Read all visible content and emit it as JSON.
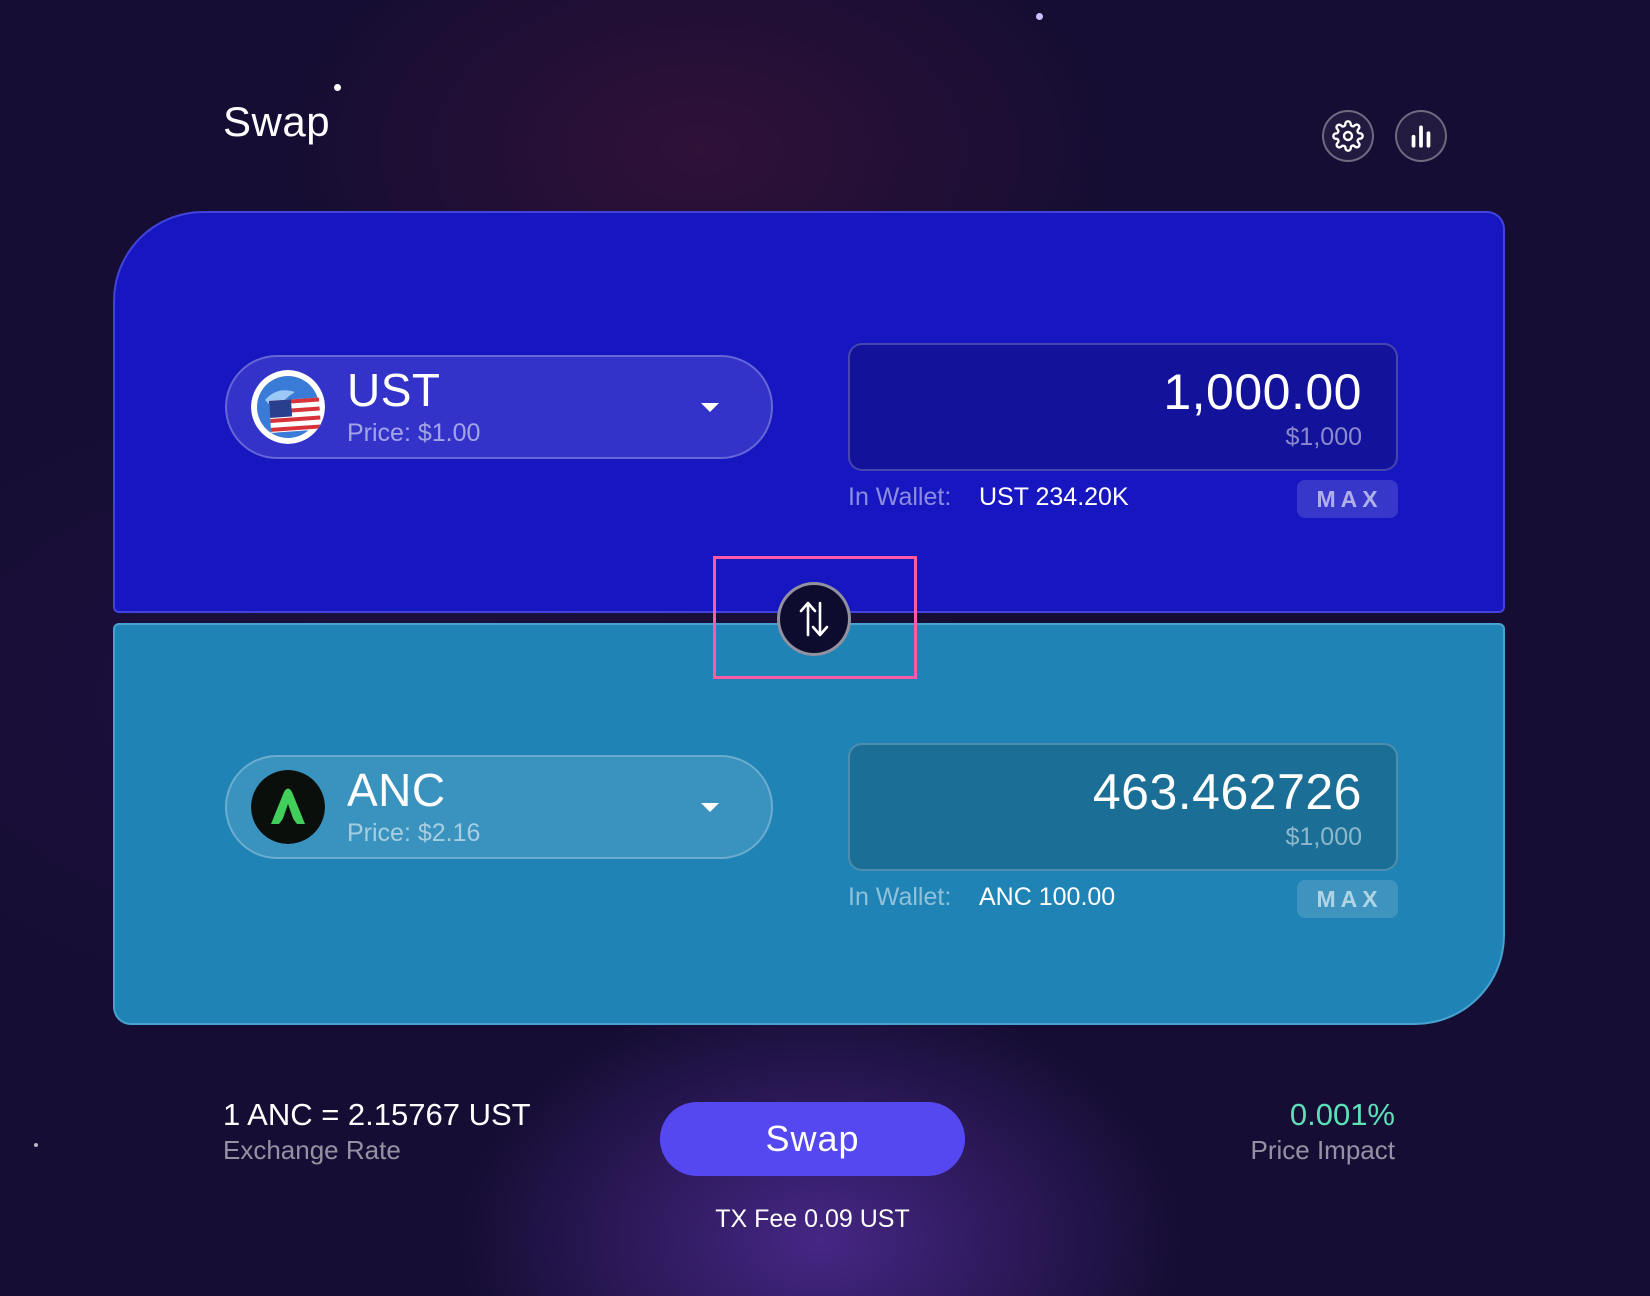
{
  "page": {
    "title": "Swap"
  },
  "toolbar": {
    "settings_icon": "gear-icon",
    "chart_icon": "bar-chart-icon"
  },
  "from": {
    "symbol": "UST",
    "price": "Price: $1.00",
    "amount": "1,000.00",
    "amount_usd": "$1,000",
    "wallet_label": "In Wallet:",
    "wallet_value": "UST 234.20K",
    "max_label": "MAX",
    "logo": "us-flag-globe-icon"
  },
  "to": {
    "symbol": "ANC",
    "price": "Price: $2.16",
    "amount": "463.462726",
    "amount_usd": "$1,000",
    "wallet_label": "In Wallet:",
    "wallet_value": "ANC 100.00",
    "max_label": "MAX",
    "logo": "anchor-a-icon"
  },
  "swap_direction_icon": "swap-arrows-icon",
  "summary": {
    "exchange_rate": "1 ANC = 2.15767 UST",
    "exchange_rate_label": "Exchange Rate",
    "swap_button": "Swap",
    "tx_fee": "TX Fee 0.09 UST",
    "price_impact": "0.001%",
    "price_impact_label": "Price Impact"
  },
  "colors": {
    "from_panel": "#1717c2",
    "to_panel": "#1f83b5",
    "swap_button": "#5548f0",
    "price_impact": "#5de0b8",
    "highlight": "#ff5aa8"
  }
}
